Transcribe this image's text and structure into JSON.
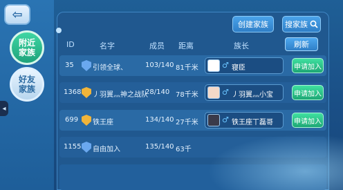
{
  "nav": {
    "back_icon": "back-arrow-icon"
  },
  "side_tabs": [
    {
      "label_line1": "附近",
      "label_line2": "家族",
      "active": true
    },
    {
      "label_line1": "好友",
      "label_line2": "家族",
      "active": false
    }
  ],
  "toolbar": {
    "create_label": "创建家族",
    "search_label": "搜家族",
    "refresh_label": "刷新"
  },
  "table": {
    "headers": {
      "id": "ID",
      "name": "名字",
      "members": "成员",
      "distance": "距离",
      "leader": "族长"
    },
    "rows": [
      {
        "id": "35",
        "name": "引领全球、",
        "members": "103/140",
        "distance": "81千米",
        "leader_gender": "♂",
        "leader": "寝臣",
        "badge_color": "#6aa8ef",
        "apply_label": "申请加入"
      },
      {
        "id": "1368",
        "name": "丿羽翼灬神之战队",
        "members": "28/140",
        "distance": "78千米",
        "leader_gender": "♂",
        "leader": "丿羽翼灬小宝",
        "badge_color": "#f0b43a",
        "apply_label": "申请加入"
      },
      {
        "id": "699",
        "name": "铁王座",
        "members": "134/140",
        "distance": "27千米",
        "leader_gender": "♂",
        "leader": "铁王座丅磊哥",
        "badge_color": "#f0b43a",
        "apply_label": "申请加入"
      },
      {
        "id": "1155",
        "name": "自由加入",
        "members": "135/140",
        "distance": "63千",
        "leader_gender": "",
        "leader": "",
        "badge_color": "#6aa8ef",
        "apply_label": ""
      }
    ]
  }
}
